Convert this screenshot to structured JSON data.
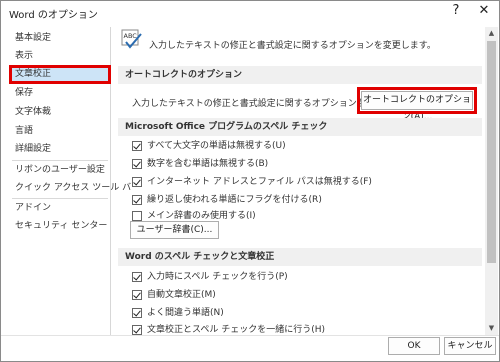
{
  "window": {
    "title": "Word のオプション",
    "help_glyph": "?",
    "close_glyph": "✕"
  },
  "sidebar": {
    "items": [
      {
        "label": "基本設定"
      },
      {
        "label": "表示"
      },
      {
        "label": "文章校正",
        "selected": true
      },
      {
        "label": "保存"
      },
      {
        "label": "文字体裁"
      },
      {
        "label": "言語"
      },
      {
        "label": "詳細設定"
      },
      {
        "label": "リボンのユーザー設定"
      },
      {
        "label": "クイック アクセス ツール バー"
      },
      {
        "label": "アドイン"
      },
      {
        "label": "セキュリティ センター"
      }
    ]
  },
  "main": {
    "intro_icon": "abc-proofing-icon",
    "intro_icon_text": "ABC",
    "intro_text": "入力したテキストの修正と書式設定に関するオプションを変更します。",
    "autocorrect": {
      "header": "オートコレクトのオプション",
      "description": "入力したテキストの修正と書式設定に関するオプションを変更します。",
      "button_label": "オートコレクトのオプション(A)..."
    },
    "office_spelling": {
      "header": "Microsoft Office プログラムのスペル チェック",
      "options": [
        {
          "label": "すべて大文字の単語は無視する(U)",
          "checked": true
        },
        {
          "label": "数字を含む単語は無視する(B)",
          "checked": true
        },
        {
          "label": "インターネット アドレスとファイル パスは無視する(F)",
          "checked": true
        },
        {
          "label": "繰り返し使われる単語にフラグを付ける(R)",
          "checked": true
        },
        {
          "label": "メイン辞書のみ使用する(I)",
          "checked": false
        }
      ],
      "dictionary_button": "ユーザー辞書(C)..."
    },
    "word_spelling": {
      "header": "Word のスペル チェックと文章校正",
      "options": [
        {
          "label": "入力時にスペル チェックを行う(P)",
          "checked": true
        },
        {
          "label": "自動文章校正(M)",
          "checked": true
        },
        {
          "label": "よく間違う単語(N)",
          "checked": true
        },
        {
          "label": "文章校正とスペル チェックを一緒に行う(H)",
          "checked": true
        }
      ]
    }
  },
  "footer": {
    "ok_label": "OK",
    "cancel_label": "キャンセル"
  },
  "colors": {
    "highlight_border": "#e00000",
    "selected_bg": "#cde4f7",
    "section_bg": "#f0f0f0"
  }
}
